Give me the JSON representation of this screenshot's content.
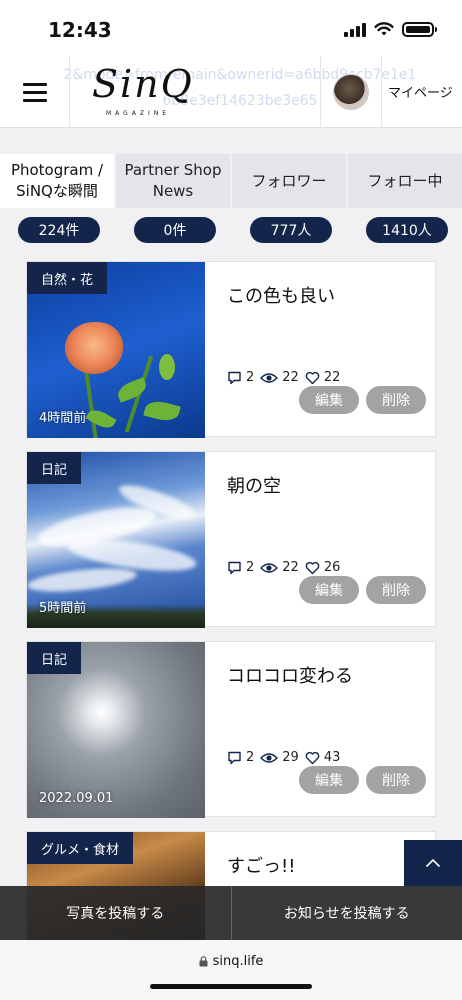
{
  "status_bar": {
    "time": "12:43"
  },
  "header": {
    "logo_text": "SinQ",
    "logo_sub": "MAGAZINE",
    "url_ghost": "2&mode=fromremain&ownerid=a6bbd9ccb7e1e1 6b8e3ef14623be3e65",
    "mypage_label": "マイページ"
  },
  "tabs": [
    {
      "label": "Photogram / SiNQな瞬間",
      "active": true
    },
    {
      "label": "Partner Shop News",
      "active": false
    },
    {
      "label": "フォロワー",
      "active": false
    },
    {
      "label": "フォロー中",
      "active": false
    }
  ],
  "counts": [
    "224件",
    "0件",
    "777人",
    "1410人"
  ],
  "posts": [
    {
      "category": "自然・花",
      "time": "4時間前",
      "title": "この色も良い",
      "comments": "2",
      "views": "22",
      "likes": "22"
    },
    {
      "category": "日記",
      "time": "5時間前",
      "title": "朝の空",
      "comments": "2",
      "views": "22",
      "likes": "26"
    },
    {
      "category": "日記",
      "time": "2022.09.01",
      "title": "コロコロ変わる",
      "comments": "2",
      "views": "29",
      "likes": "43"
    },
    {
      "category": "グルメ・食材",
      "time": "",
      "title": "すごっ!!",
      "comments": "",
      "views": "",
      "likes": ""
    }
  ],
  "actions": {
    "edit": "編集",
    "delete": "削除"
  },
  "bottom_bar": {
    "post_photo": "写真を投稿する",
    "post_news": "お知らせを投稿する"
  },
  "safari": {
    "url": "sinq.life"
  },
  "colors": {
    "navy": "#13254a",
    "button_gray": "#a3a3a3",
    "tab_bg": "#e4e5ea"
  }
}
